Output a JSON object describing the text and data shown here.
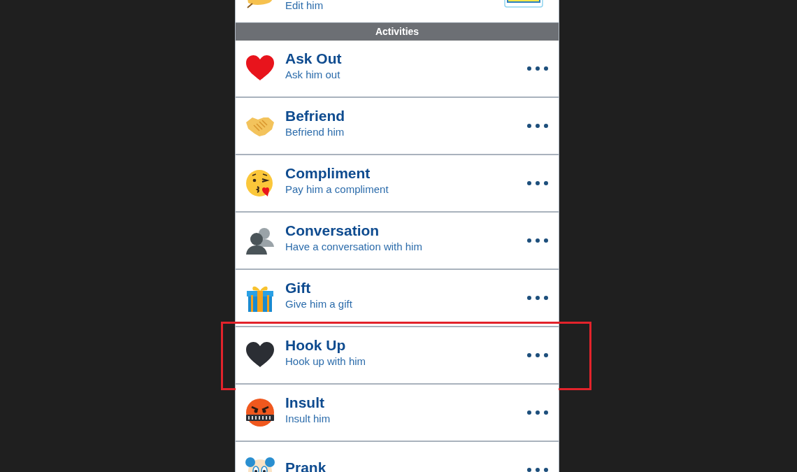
{
  "top_item": {
    "subtitle": "Edit him"
  },
  "section": {
    "title": "Activities"
  },
  "activities": [
    {
      "title": "Ask Out",
      "subtitle": "Ask him out",
      "highlighted": false
    },
    {
      "title": "Befriend",
      "subtitle": "Befriend him",
      "highlighted": false
    },
    {
      "title": "Compliment",
      "subtitle": "Pay him a compliment",
      "highlighted": false
    },
    {
      "title": "Conversation",
      "subtitle": "Have a conversation with him",
      "highlighted": false
    },
    {
      "title": "Gift",
      "subtitle": "Give him a gift",
      "highlighted": false
    },
    {
      "title": "Hook Up",
      "subtitle": "Hook up with him",
      "highlighted": true
    },
    {
      "title": "Insult",
      "subtitle": "Insult him",
      "highlighted": false
    },
    {
      "title": "Prank",
      "highlighted": false
    }
  ]
}
